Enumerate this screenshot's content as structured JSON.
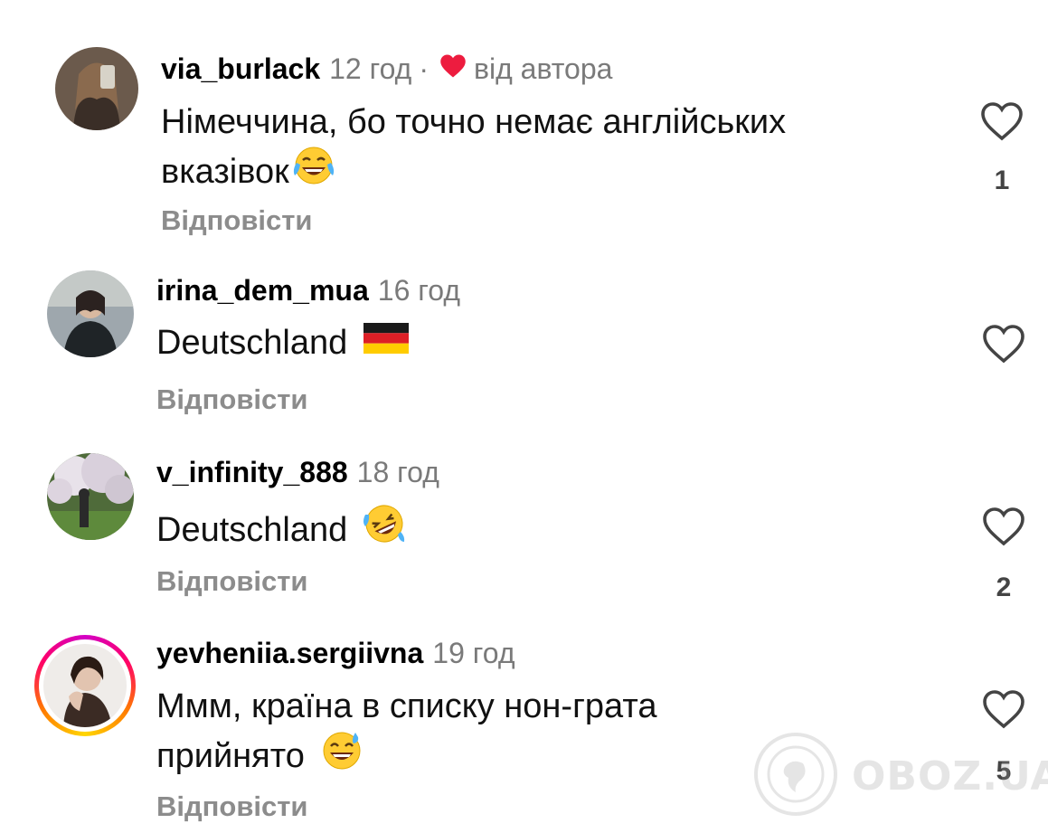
{
  "comments": [
    {
      "username": "via_burlack",
      "time": "12 год",
      "separator": "·",
      "author_note": "від автора",
      "text_line1": "Німеччина, бо точно немає англійських",
      "text_line2": "вказівок",
      "emoji": "tears-of-joy-emoji",
      "reply": "Відповісти",
      "likes": "1"
    },
    {
      "username": "irina_dem_mua",
      "time": "16 год",
      "text_line1": "Deutschland",
      "emoji": "german-flag-emoji",
      "reply": "Відповісти",
      "likes": ""
    },
    {
      "username": "v_infinity_888",
      "time": "18 год",
      "text_line1": "Deutschland",
      "emoji": "rolling-laughing-emoji",
      "reply": "Відповісти",
      "likes": "2"
    },
    {
      "username": "yevheniia.sergiivna",
      "time": "19 год",
      "text_line1": "Ммм, країна в списку нон-грата",
      "text_line2": "прийнято",
      "emoji": "sweat-smile-emoji",
      "reply": "Відповісти",
      "likes": "5",
      "has_story_ring": true
    }
  ],
  "watermark": {
    "text": "OBOZ.UA"
  },
  "colors": {
    "heart_red": "#ed1c3f",
    "muted": "#7a7a7a",
    "reply_gray": "#8c8c8c"
  }
}
